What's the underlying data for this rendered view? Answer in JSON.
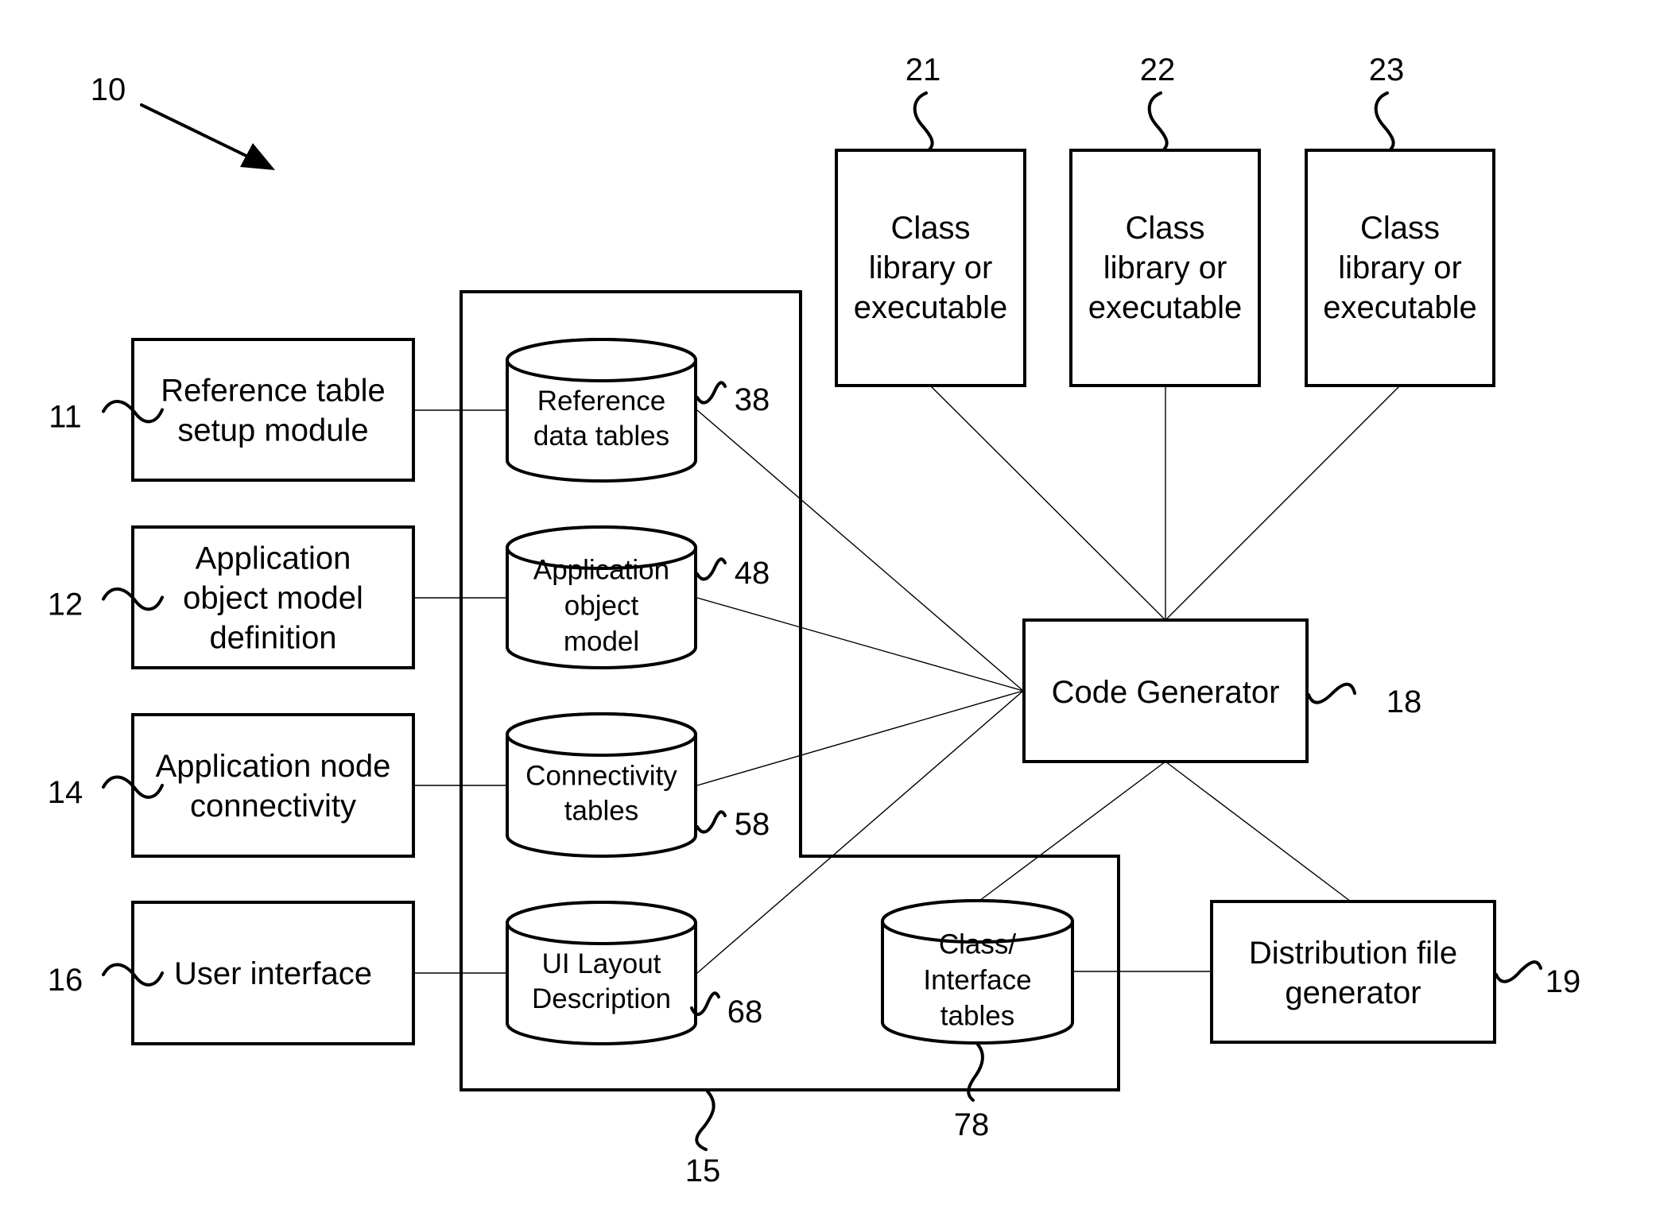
{
  "figure": {
    "reference": "10"
  },
  "modules": [
    {
      "ref": "11",
      "lines": [
        "Reference table",
        "setup module"
      ]
    },
    {
      "ref": "12",
      "lines": [
        "Application",
        "object model",
        "definition"
      ]
    },
    {
      "ref": "14",
      "lines": [
        "Application node",
        "connectivity"
      ]
    },
    {
      "ref": "16",
      "lines": [
        "User interface"
      ]
    }
  ],
  "repository": {
    "ref": "15",
    "tables": [
      {
        "ref": "38",
        "lines": [
          "Reference",
          "data tables"
        ]
      },
      {
        "ref": "48",
        "lines": [
          "Application",
          "object",
          "model"
        ]
      },
      {
        "ref": "58",
        "lines": [
          "Connectivity",
          "tables"
        ]
      },
      {
        "ref": "68",
        "lines": [
          "UI Layout",
          "Description"
        ]
      },
      {
        "ref": "78",
        "lines": [
          "Class/",
          "Interface",
          "tables"
        ]
      }
    ]
  },
  "libraries": [
    {
      "ref": "21",
      "lines": [
        "Class",
        "library or",
        "executable"
      ]
    },
    {
      "ref": "22",
      "lines": [
        "Class",
        "library or",
        "executable"
      ]
    },
    {
      "ref": "23",
      "lines": [
        "Class",
        "library or",
        "executable"
      ]
    }
  ],
  "code_generator": {
    "ref": "18",
    "lines": [
      "Code Generator"
    ]
  },
  "distribution": {
    "ref": "19",
    "lines": [
      "Distribution file",
      "generator"
    ]
  },
  "connections": [
    [
      "11",
      "38"
    ],
    [
      "12",
      "48"
    ],
    [
      "14",
      "58"
    ],
    [
      "16",
      "68"
    ],
    [
      "38",
      "18"
    ],
    [
      "48",
      "18"
    ],
    [
      "58",
      "18"
    ],
    [
      "68",
      "18"
    ],
    [
      "21",
      "18"
    ],
    [
      "22",
      "18"
    ],
    [
      "23",
      "18"
    ],
    [
      "18",
      "78"
    ],
    [
      "18",
      "19"
    ],
    [
      "78",
      "19"
    ]
  ]
}
